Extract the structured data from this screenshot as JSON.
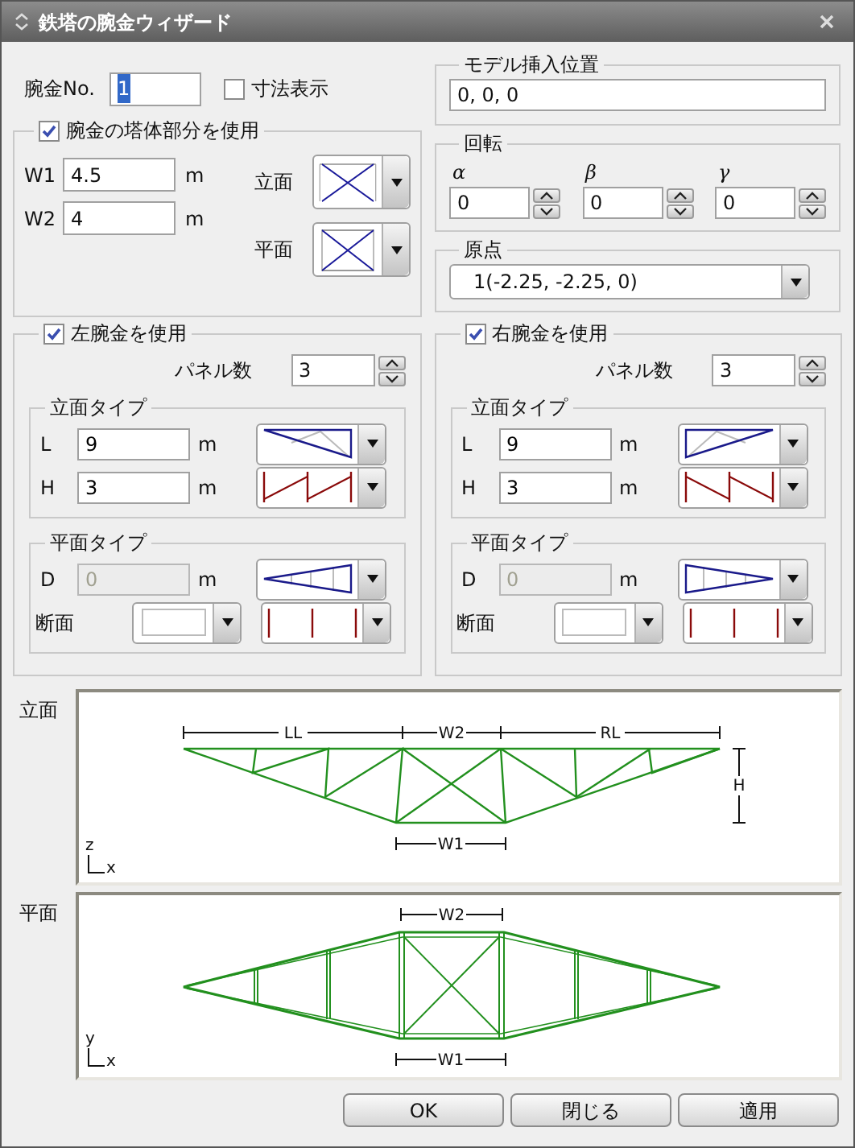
{
  "window": {
    "title": "鉄塔の腕金ウィザード"
  },
  "arm_no": {
    "label": "腕金No.",
    "value": "1",
    "text_selected": true
  },
  "show_dimensions": {
    "label": "寸法表示",
    "checked": false
  },
  "tower_part": {
    "label": "腕金の塔体部分を使用",
    "checked": true,
    "fields": [
      {
        "label": "W1",
        "value": "4.5",
        "unit": "m"
      },
      {
        "label": "W2",
        "value": "4",
        "unit": "m"
      }
    ],
    "views": [
      {
        "label": "立面",
        "kind": "xelev"
      },
      {
        "label": "平面",
        "kind": "xplan"
      }
    ]
  },
  "insert_position": {
    "title": "モデル挿入位置",
    "value": "0, 0, 0"
  },
  "rotation": {
    "title": "回転",
    "angles": [
      {
        "label": "α",
        "value": "0"
      },
      {
        "label": "β",
        "value": "0"
      },
      {
        "label": "γ",
        "value": "0"
      }
    ]
  },
  "origin": {
    "title": "原点",
    "value": "1(-2.25, -2.25, 0)"
  },
  "arms": [
    {
      "label": "左腕金を使用",
      "checked": true,
      "mirrored": false,
      "panel_label": "パネル数",
      "panels": "3",
      "elevation": {
        "title": "立面タイプ",
        "rows": [
          {
            "kind": "field",
            "label": "L",
            "value": "9",
            "unit": "m",
            "disabled": false,
            "combo": {
              "kind": "taper"
            }
          },
          {
            "kind": "field",
            "label": "H",
            "value": "3",
            "unit": "m",
            "disabled": false,
            "combo": {
              "kind": "zigzag"
            }
          }
        ]
      },
      "plan": {
        "title": "平面タイプ",
        "rows": [
          {
            "kind": "field",
            "label": "D",
            "value": "0",
            "unit": "m",
            "disabled": true,
            "combo": {
              "kind": "wedge"
            }
          },
          {
            "kind": "section",
            "label": "断面",
            "combo": {
              "kind": "verticals"
            }
          }
        ]
      }
    },
    {
      "label": "右腕金を使用",
      "checked": true,
      "mirrored": true,
      "panel_label": "パネル数",
      "panels": "3",
      "elevation": {
        "title": "立面タイプ",
        "rows": [
          {
            "kind": "field",
            "label": "L",
            "value": "9",
            "unit": "m",
            "disabled": false,
            "combo": {
              "kind": "taper"
            }
          },
          {
            "kind": "field",
            "label": "H",
            "value": "3",
            "unit": "m",
            "disabled": false,
            "combo": {
              "kind": "zigzag"
            }
          }
        ]
      },
      "plan": {
        "title": "平面タイプ",
        "rows": [
          {
            "kind": "field",
            "label": "D",
            "value": "0",
            "unit": "m",
            "disabled": true,
            "combo": {
              "kind": "wedge"
            }
          },
          {
            "kind": "section",
            "label": "断面",
            "combo": {
              "kind": "verticals"
            }
          }
        ]
      }
    }
  ],
  "previews": [
    {
      "label": "立面",
      "kind": "elevation",
      "dims": [
        "LL",
        "W2",
        "RL",
        "W1",
        "H"
      ],
      "axes": [
        "z",
        "x"
      ]
    },
    {
      "label": "平面",
      "kind": "plan",
      "dims": [
        "W2",
        "W1"
      ],
      "axes": [
        "y",
        "x"
      ]
    }
  ],
  "buttons": [
    "OK",
    "閉じる",
    "適用"
  ]
}
